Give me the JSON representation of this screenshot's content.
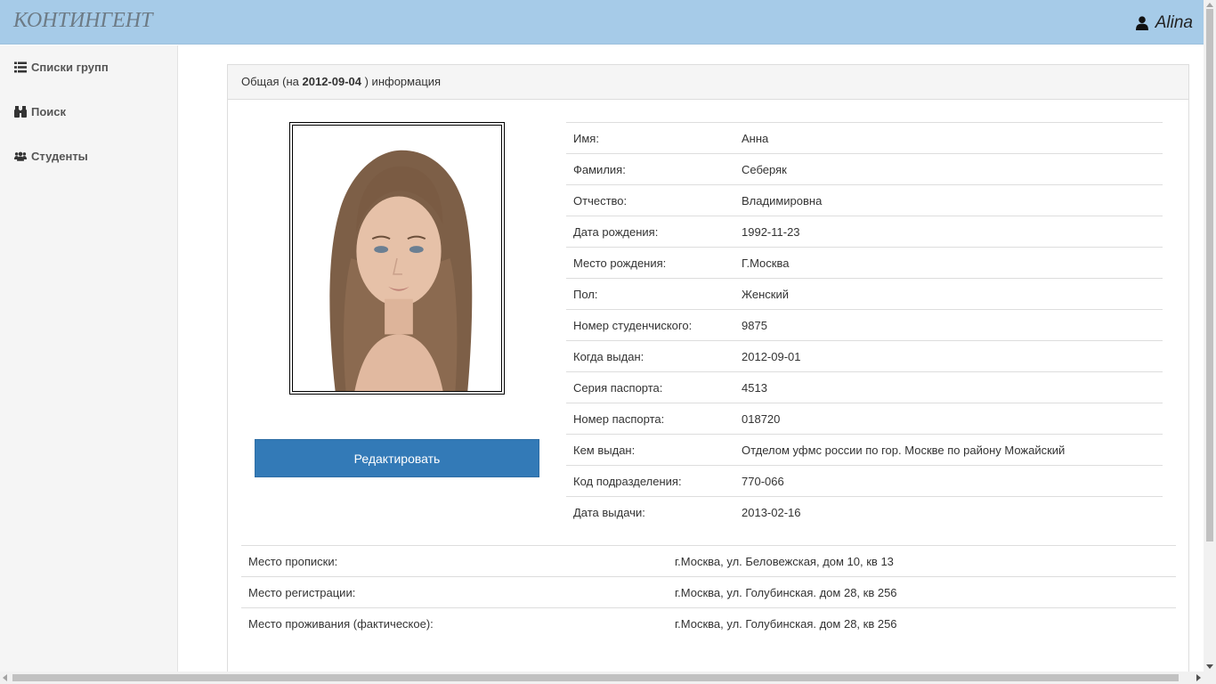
{
  "app": {
    "brand": "КОНТИНГЕНТ",
    "user_name": "Alina"
  },
  "sidebar": {
    "items": [
      {
        "label": "Списки групп",
        "icon": "list-icon"
      },
      {
        "label": "Поиск",
        "icon": "binoculars-icon"
      },
      {
        "label": "Студенты",
        "icon": "users-icon"
      }
    ]
  },
  "panel": {
    "heading_prefix": "Общая (на ",
    "heading_date": "2012-09-04",
    "heading_suffix": " ) информация"
  },
  "actions": {
    "edit_label": "Редактировать"
  },
  "info": [
    {
      "label": "Имя:",
      "value": "Анна"
    },
    {
      "label": "Фамилия:",
      "value": "Себеряк"
    },
    {
      "label": "Отчество:",
      "value": "Владимировна"
    },
    {
      "label": "Дата рождения:",
      "value": "1992-11-23"
    },
    {
      "label": "Место рождения:",
      "value": "Г.Москва"
    },
    {
      "label": "Пол:",
      "value": "Женский"
    },
    {
      "label": "Номер студенчиского:",
      "value": "9875"
    },
    {
      "label": "Когда выдан:",
      "value": "2012-09-01"
    },
    {
      "label": "Серия паспорта:",
      "value": "4513"
    },
    {
      "label": "Номер паспорта:",
      "value": "018720"
    },
    {
      "label": "Кем выдан:",
      "value": "Отделом уфмс россии по гор. Москве по району Можайский"
    },
    {
      "label": "Код подразделения:",
      "value": "770-066"
    },
    {
      "label": "Дата выдачи:",
      "value": "2013-02-16"
    }
  ],
  "addresses": [
    {
      "label": "Место прописки:",
      "value": "г.Москва, ул. Беловежская, дом 10, кв 13"
    },
    {
      "label": "Место регистрации:",
      "value": "г.Москва, ул. Голубинская. дом 28, кв 256"
    },
    {
      "label": "Место проживания (фактическое):",
      "value": "г.Москва, ул. Голубинская. дом 28, кв 256"
    }
  ],
  "colors": {
    "navbar": "#a6cbe8",
    "button": "#337ab7",
    "sidebar": "#f5f5f5"
  }
}
